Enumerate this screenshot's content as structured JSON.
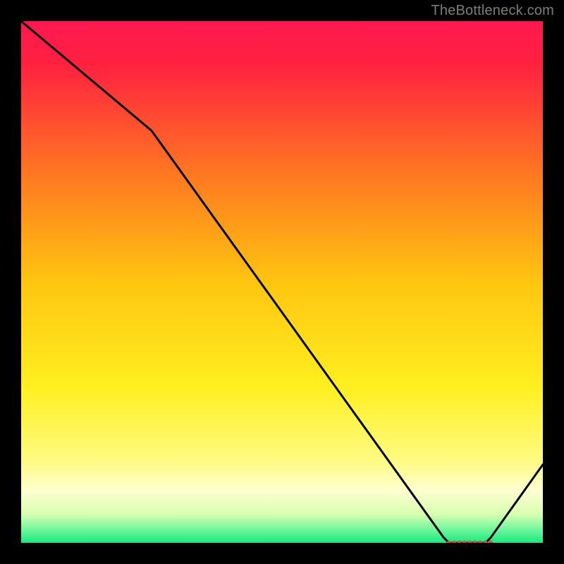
{
  "attribution": "TheBottleneck.com",
  "chart_data": {
    "type": "line",
    "title": "",
    "xlabel": "",
    "ylabel": "",
    "xlim": [
      0,
      100
    ],
    "ylim": [
      0,
      100
    ],
    "grid": false,
    "legend": false,
    "background_gradient": {
      "stops": [
        {
          "pos": 0.0,
          "color": "#ff1850"
        },
        {
          "pos": 0.08,
          "color": "#ff2040"
        },
        {
          "pos": 0.3,
          "color": "#ff7a20"
        },
        {
          "pos": 0.5,
          "color": "#ffc510"
        },
        {
          "pos": 0.7,
          "color": "#ffef20"
        },
        {
          "pos": 0.84,
          "color": "#fffb80"
        },
        {
          "pos": 0.9,
          "color": "#fffed0"
        },
        {
          "pos": 0.945,
          "color": "#d8ffb0"
        },
        {
          "pos": 0.97,
          "color": "#80f8a0"
        },
        {
          "pos": 1.0,
          "color": "#18e880"
        }
      ]
    },
    "series": [
      {
        "name": "bottleneck-curve",
        "stroke": "#000000",
        "stroke_width": 3,
        "x": [
          0,
          25,
          81,
          82,
          83,
          85,
          86,
          87,
          88,
          89,
          90,
          100
        ],
        "values": [
          100,
          79,
          1,
          0,
          0,
          0,
          0,
          0,
          0,
          0,
          1,
          15
        ]
      }
    ],
    "markers": {
      "name": "bottom-dots",
      "color": "#ff3a3a",
      "radius": 3.2,
      "x": [
        82,
        83,
        84,
        85,
        86,
        87,
        88,
        89,
        90
      ],
      "y": [
        0,
        0,
        0,
        0,
        0,
        0,
        0,
        0,
        0
      ]
    }
  }
}
